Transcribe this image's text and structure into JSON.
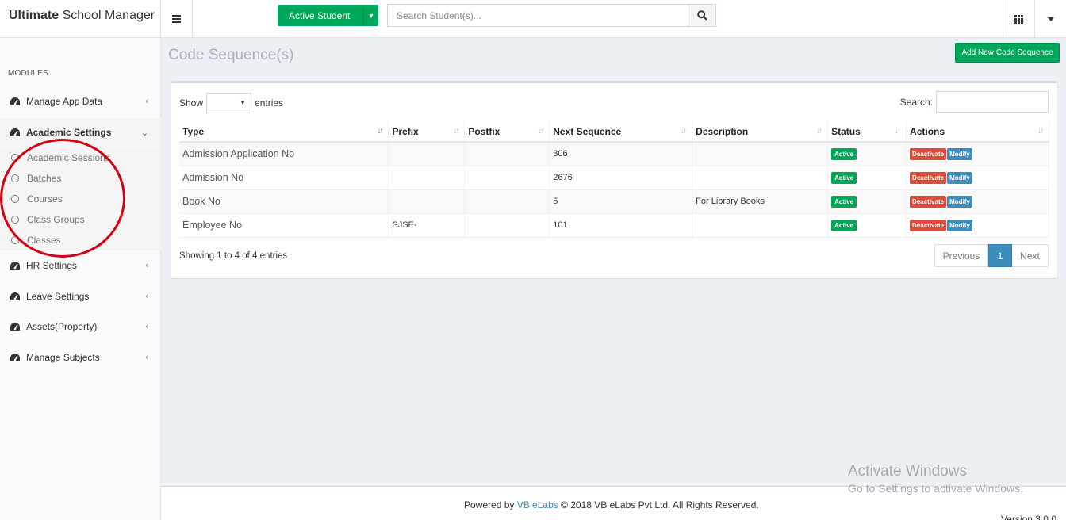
{
  "header": {
    "brand_bold": "Ultimate",
    "brand_rest": " School Manager",
    "active_student_label": "Active Student",
    "search_placeholder": "Search Student(s)..."
  },
  "sidebar": {
    "modules_label": "MODULES",
    "items": [
      {
        "label": "Manage App Data"
      },
      {
        "label": "Academic Settings"
      },
      {
        "label": "HR Settings"
      },
      {
        "label": "Leave Settings"
      },
      {
        "label": "Assets(Property)"
      },
      {
        "label": "Manage Subjects"
      }
    ],
    "submenu": [
      {
        "label": "Academic Sessions"
      },
      {
        "label": "Batches"
      },
      {
        "label": "Courses"
      },
      {
        "label": "Class Groups"
      },
      {
        "label": "Classes"
      }
    ]
  },
  "page": {
    "title": "Code Sequence(s)",
    "add_button": "Add New Code Sequence"
  },
  "table_controls": {
    "show_label": "Show",
    "entries_label": "entries",
    "search_label": "Search:"
  },
  "table": {
    "columns": [
      "Type",
      "Prefix",
      "Postfix",
      "Next Sequence",
      "Description",
      "Status",
      "Actions"
    ],
    "rows": [
      {
        "type": "Admission Application No",
        "prefix": "",
        "postfix": "",
        "next": "306",
        "description": "",
        "status": "Active"
      },
      {
        "type": "Admission No",
        "prefix": "",
        "postfix": "",
        "next": "2676",
        "description": "",
        "status": "Active"
      },
      {
        "type": "Book No",
        "prefix": "",
        "postfix": "",
        "next": "5",
        "description": "For Library Books",
        "status": "Active"
      },
      {
        "type": "Employee No",
        "prefix": "SJSE-",
        "postfix": "",
        "next": "101",
        "description": "",
        "status": "Active"
      }
    ],
    "deactivate_label": "Deactivate",
    "modify_label": "Modify"
  },
  "pagination": {
    "info": "Showing 1 to 4 of 4 entries",
    "previous": "Previous",
    "current": "1",
    "next": "Next"
  },
  "footer": {
    "powered_by": "Powered by ",
    "vb_link": "VB eLabs",
    "copyright": " © 2018 VB eLabs Pvt Ltd. All Rights Reserved.",
    "version": "Version 3.0.0"
  },
  "watermark": {
    "line1": "Activate Windows",
    "line2": "Go to Settings to activate Windows."
  },
  "colors": {
    "green": "#00a65a",
    "red": "#dd4b39",
    "blue": "#3c8dbc",
    "annotation_red": "#d60012"
  }
}
